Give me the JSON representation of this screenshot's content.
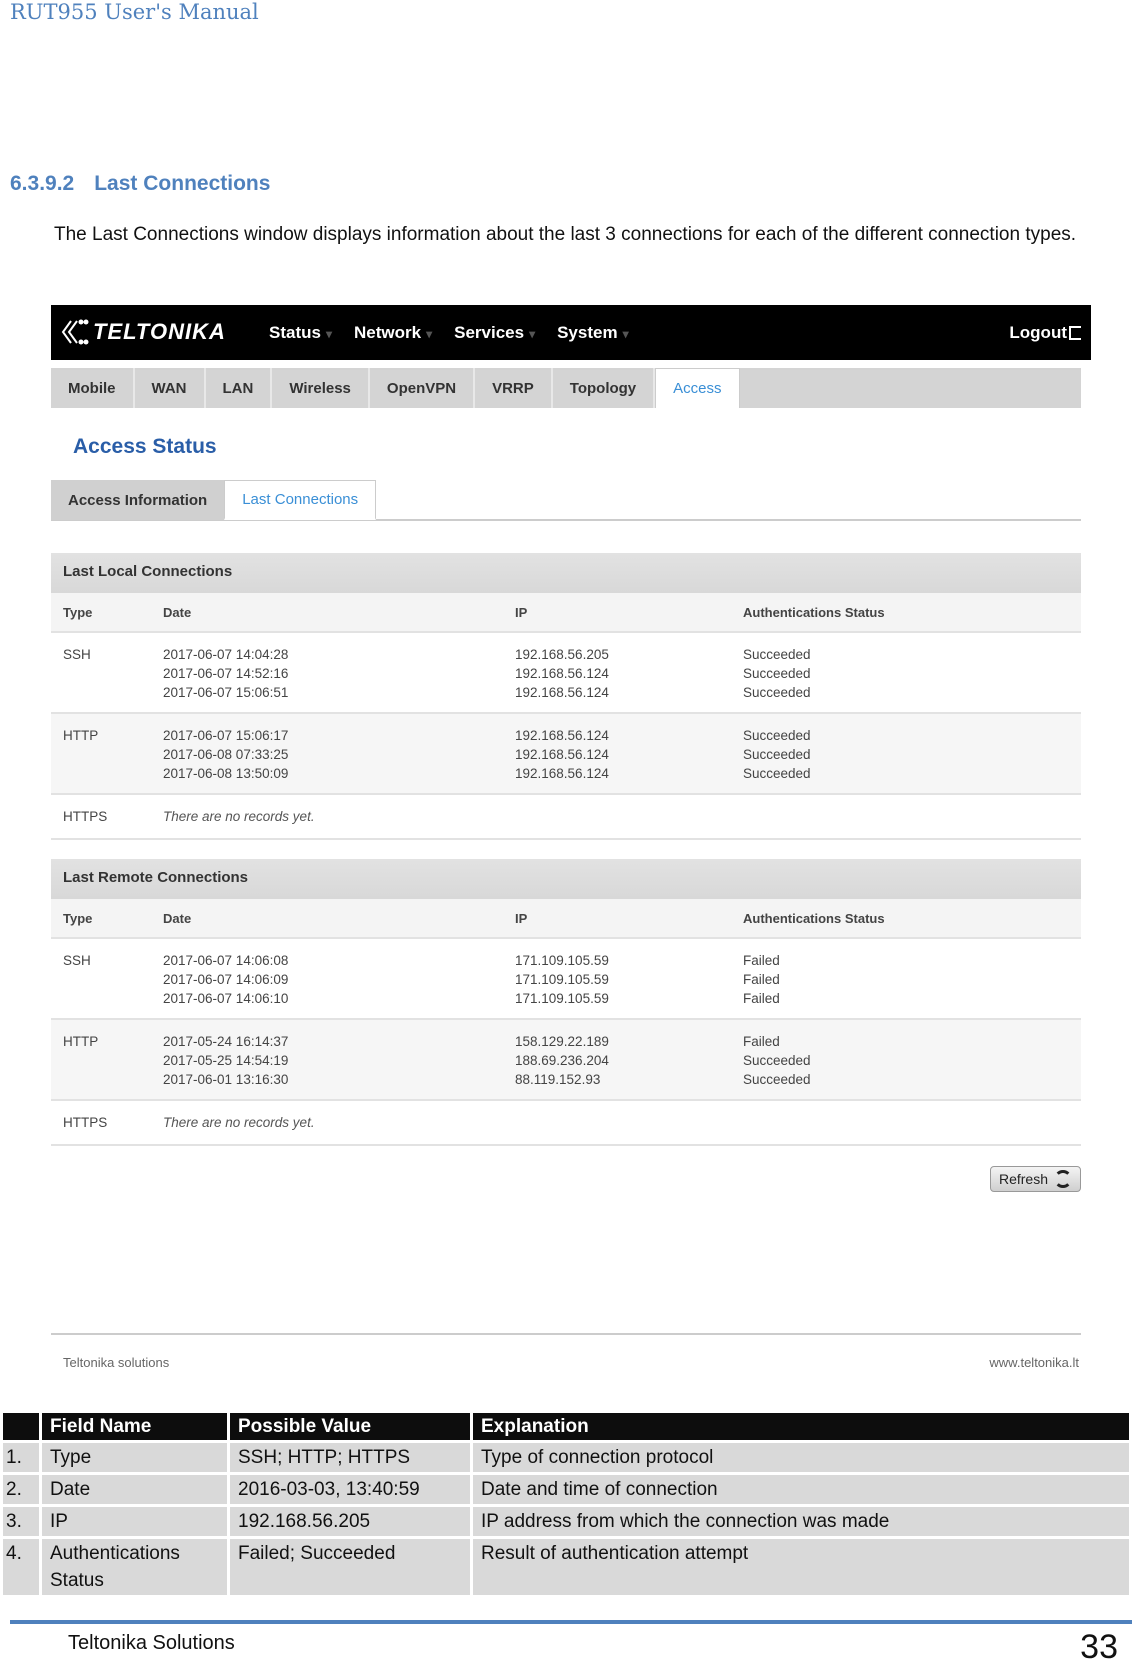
{
  "document": {
    "header": "RUT955 User's Manual",
    "section_number": "6.3.9.2",
    "section_title": "Last Connections",
    "intro": "The Last Connections window displays information about the last 3 connections for each of the different connection types.",
    "footer_company": "Teltonika Solutions",
    "page_number": "33"
  },
  "screenshot": {
    "brand": "TELTONIKA",
    "nav": [
      "Status",
      "Network",
      "Services",
      "System"
    ],
    "logout_label": "Logout",
    "tabs": [
      "Mobile",
      "WAN",
      "LAN",
      "Wireless",
      "OpenVPN",
      "VRRP",
      "Topology",
      "Access"
    ],
    "active_tab": "Access",
    "page_title": "Access Status",
    "subtabs": [
      "Access Information",
      "Last Connections"
    ],
    "active_subtab": "Last Connections",
    "columns": [
      "Type",
      "Date",
      "IP",
      "Authentications Status"
    ],
    "local": {
      "title": "Last Local Connections",
      "rows": [
        {
          "type": "SSH",
          "dates": [
            "2017-06-07 14:04:28",
            "2017-06-07 14:52:16",
            "2017-06-07 15:06:51"
          ],
          "ips": [
            "192.168.56.205",
            "192.168.56.124",
            "192.168.56.124"
          ],
          "statuses": [
            "Succeeded",
            "Succeeded",
            "Succeeded"
          ]
        },
        {
          "type": "HTTP",
          "dates": [
            "2017-06-07 15:06:17",
            "2017-06-08 07:33:25",
            "2017-06-08 13:50:09"
          ],
          "ips": [
            "192.168.56.124",
            "192.168.56.124",
            "192.168.56.124"
          ],
          "statuses": [
            "Succeeded",
            "Succeeded",
            "Succeeded"
          ]
        },
        {
          "type": "HTTPS",
          "empty": "There are no records yet."
        }
      ]
    },
    "remote": {
      "title": "Last Remote Connections",
      "rows": [
        {
          "type": "SSH",
          "dates": [
            "2017-06-07 14:06:08",
            "2017-06-07 14:06:09",
            "2017-06-07 14:06:10"
          ],
          "ips": [
            "171.109.105.59",
            "171.109.105.59",
            "171.109.105.59"
          ],
          "statuses": [
            "Failed",
            "Failed",
            "Failed"
          ]
        },
        {
          "type": "HTTP",
          "dates": [
            "2017-05-24 16:14:37",
            "2017-05-25 14:54:19",
            "2017-06-01 13:16:30"
          ],
          "ips": [
            "158.129.22.189",
            "188.69.236.204",
            "88.119.152.93"
          ],
          "statuses": [
            "Failed",
            "Succeeded",
            "Succeeded"
          ]
        },
        {
          "type": "HTTPS",
          "empty": "There are no records yet."
        }
      ]
    },
    "refresh_label": "Refresh",
    "footer_left": "Teltonika solutions",
    "footer_right": "www.teltonika.lt"
  },
  "field_table": {
    "headers": [
      "",
      "Field Name",
      "Possible Value",
      "Explanation"
    ],
    "rows": [
      {
        "n": "1.",
        "field": "Type",
        "value": "SSH; HTTP; HTTPS",
        "explanation": "Type of connection protocol"
      },
      {
        "n": "2.",
        "field": "Date",
        "value": "2016-03-03, 13:40:59",
        "explanation": "Date and time of connection"
      },
      {
        "n": "3.",
        "field": "IP",
        "value": "192.168.56.205",
        "explanation": "IP address from which the connection was made"
      },
      {
        "n": "4.",
        "field": "Authentications Status",
        "value": "Failed; Succeeded",
        "explanation": "Result of authentication attempt"
      }
    ]
  },
  "colors": {
    "doc_accent": "#4f81bd",
    "link_blue": "#3a8fd6",
    "title_blue": "#2a5ea8",
    "navbar": "#000000"
  }
}
